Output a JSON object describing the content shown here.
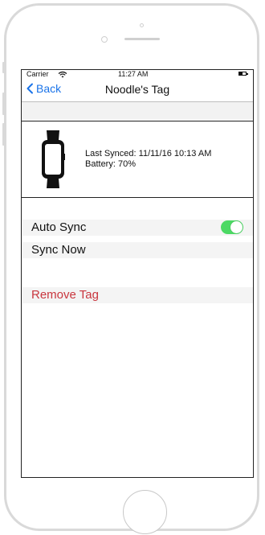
{
  "status_bar": {
    "carrier": "Carrier",
    "time": "11:27 AM",
    "wifi_icon": "wifi-icon",
    "battery_icon": "battery-icon"
  },
  "nav": {
    "back_label": "Back",
    "title": "Noodle's Tag"
  },
  "device": {
    "icon": "smartwatch-icon",
    "last_synced": "Last Synced: 11/11/16 10:13 AM",
    "battery": "Battery: 70%"
  },
  "settings": {
    "auto_sync_label": "Auto Sync",
    "auto_sync_on": true,
    "sync_now_label": "Sync Now",
    "remove_tag_label": "Remove Tag"
  },
  "colors": {
    "accent": "#1a73e8",
    "toggle_on": "#4cd964",
    "destructive": "#c9363e"
  }
}
